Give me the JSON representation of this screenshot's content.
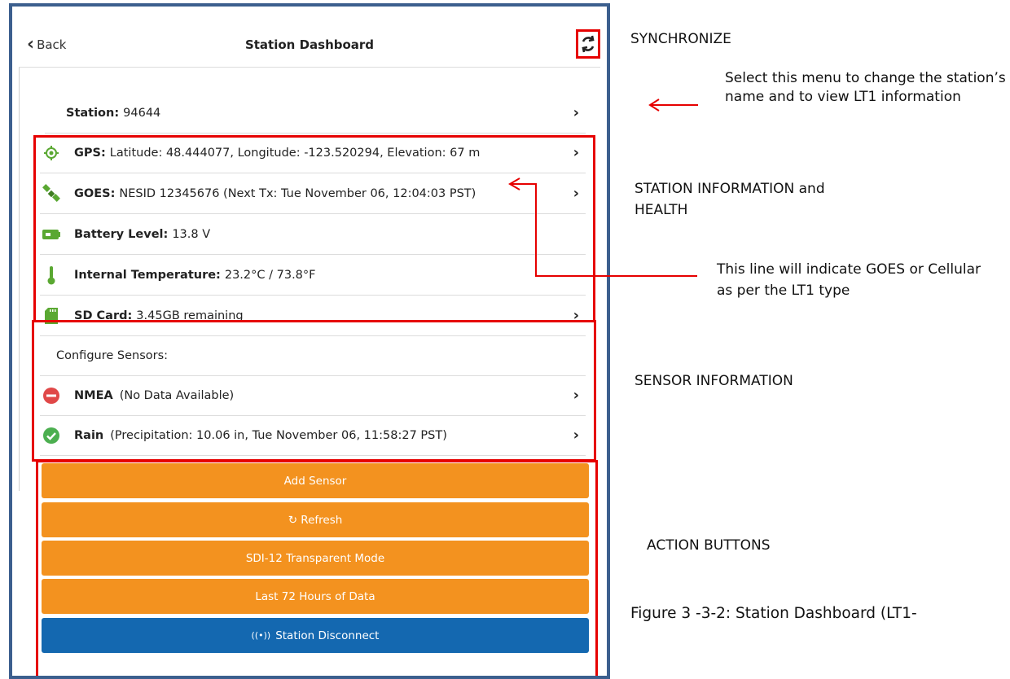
{
  "app": {
    "back_label": "Back",
    "title": "Station Dashboard"
  },
  "station": {
    "label": "Station:",
    "value": "94644"
  },
  "info_rows": [
    {
      "label": "GPS:",
      "value": "Latitude: 48.444077, Longitude: -123.520294, Elevation: 67 m",
      "icon": "gps-target-icon",
      "has_arrow": true
    },
    {
      "label": "GOES:",
      "value": "NESID 12345676 (Next Tx: Tue November 06, 12:04:03 PST)",
      "icon": "satellite-icon",
      "has_arrow": true
    },
    {
      "label": "Battery Level:",
      "value": "13.8 V",
      "icon": "battery-icon",
      "has_arrow": false
    },
    {
      "label": "Internal Temperature:",
      "value": "23.2°C / 73.8°F",
      "icon": "thermometer-icon",
      "has_arrow": false
    },
    {
      "label": "SD Card:",
      "value": "3.45GB remaining",
      "icon": "sd-card-icon",
      "has_arrow": true
    }
  ],
  "sensors": {
    "heading": "Configure Sensors:",
    "items": [
      {
        "label": "NMEA",
        "detail": "(No Data Available)",
        "status": "error"
      },
      {
        "label": "Rain",
        "detail": "(Precipitation: 10.06 in, Tue November 06, 11:58:27 PST)",
        "status": "ok"
      }
    ]
  },
  "buttons": {
    "add_sensor": "Add Sensor",
    "refresh": "↻ Refresh",
    "sdi12": "SDI-12 Transparent Mode",
    "last72": "Last 72 Hours of Data",
    "disconnect": "Station Disconnect"
  },
  "annotations": {
    "synchronize": "SYNCHRONIZE",
    "station_menu": "Select this menu to change the station’s name and to view LT1 information",
    "station_info": "STATION INFORMATION and HEALTH",
    "goes_note": "This line will indicate GOES or Cellular as per the LT1 type",
    "sensor_info": "SENSOR INFORMATION",
    "action_buttons": "ACTION BUTTONS",
    "figure_caption": "Figure 3 -3-2:  Station Dashboard (LT1-"
  },
  "colors": {
    "frame": "#3c5f8e",
    "highlight": "#e60000",
    "orange": "#f3921f",
    "blue": "#1468b0",
    "green": "#4caf50",
    "red": "#e04848"
  }
}
